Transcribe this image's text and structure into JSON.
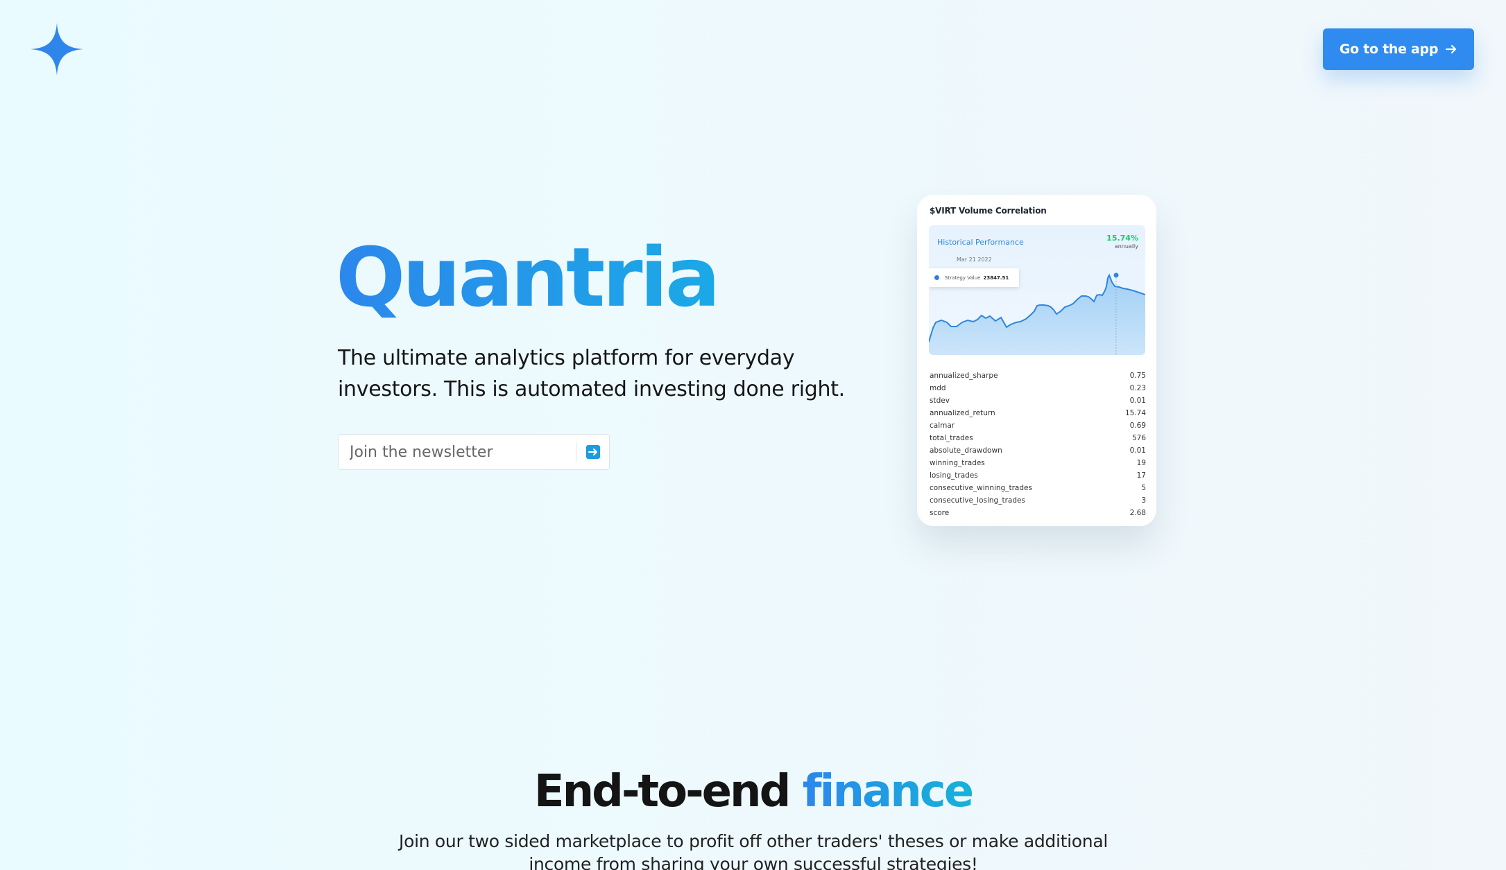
{
  "header": {
    "logo_icon": "four-point-star-icon",
    "cta_label": "Go to the app",
    "cta_icon": "arrow-right-icon"
  },
  "hero": {
    "title": "Quantria",
    "subtitle": "The ultimate analytics platform for everyday investors. This is automated investing done right.",
    "newsletter_placeholder": "Join the newsletter",
    "submit_icon": "arrow-right-box-icon"
  },
  "card": {
    "title": "$VIRT Volume Correlation",
    "chart_label": "Historical Performance",
    "return_pct": "15.74%",
    "return_period": "annually",
    "tooltip_date": "Mar 21 2022",
    "tooltip_label": "Strategy Value",
    "tooltip_value": "23847.51",
    "stats": [
      {
        "name": "annualized_sharpe",
        "value": "0.75"
      },
      {
        "name": "mdd",
        "value": "0.23"
      },
      {
        "name": "stdev",
        "value": "0.01"
      },
      {
        "name": "annualized_return",
        "value": "15.74"
      },
      {
        "name": "calmar",
        "value": "0.69"
      },
      {
        "name": "total_trades",
        "value": "576"
      },
      {
        "name": "absolute_drawdown",
        "value": "0.01"
      },
      {
        "name": "winning_trades",
        "value": "19"
      },
      {
        "name": "losing_trades",
        "value": "17"
      },
      {
        "name": "consecutive_winning_trades",
        "value": "5"
      },
      {
        "name": "consecutive_losing_trades",
        "value": "3"
      },
      {
        "name": "score",
        "value": "2.68"
      }
    ]
  },
  "section": {
    "title_plain": "End-to-end",
    "title_accent": "finance",
    "subtitle": "Join our two sided marketplace to profit off other traders' theses or make additional income from sharing your own successful strategies!"
  },
  "colors": {
    "brand": "#2f8bef",
    "accent_cyan": "#1ba9e6",
    "positive": "#1fc86a"
  }
}
